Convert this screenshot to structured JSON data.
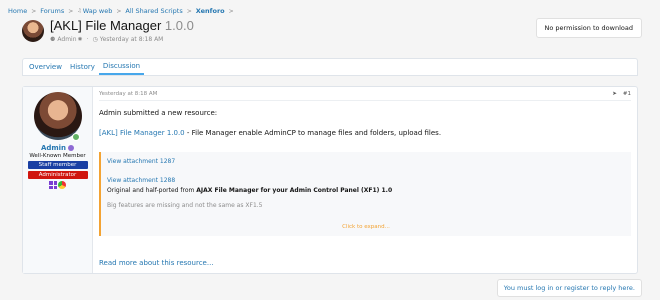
{
  "breadcrumb": [
    {
      "label": "Home"
    },
    {
      "label": "Forums"
    },
    {
      "label": "Wap web",
      "prefix": "♫"
    },
    {
      "label": "All Shared Scripts"
    },
    {
      "label": "Xenforo"
    }
  ],
  "resource": {
    "title": "[AKL] File Manager",
    "version": "1.0.0",
    "author": "Admin",
    "time": "Yesterday at 8:18 AM"
  },
  "download": {
    "label": "No permission to download"
  },
  "tabs": [
    {
      "label": "Overview"
    },
    {
      "label": "History"
    },
    {
      "label": "Discussion",
      "active": true
    }
  ],
  "post": {
    "user": {
      "name": "Admin",
      "title": "Well-Known Member",
      "banners": [
        "Staff member",
        "Administrator"
      ]
    },
    "time": "Yesterday at 8:18 AM",
    "number": "#1",
    "intro": "Admin submitted a new resource:",
    "link_text": "[AKL] File Manager 1.0.0",
    "desc_rest": " - File Manager enable AdminCP to manage files and folders, upload files.",
    "quote": {
      "attachment1": "View attachment 1287",
      "attachment2": "View attachment 1288",
      "line_prefix": "Original and half-ported from ",
      "line_bold": "AJAX File Manager for your Admin Control Panel (XF1) 1.0",
      "muted": "Big features are missing and not the same as XF1.5",
      "expand": "Click to expand..."
    },
    "read_more": "Read more about this resource..."
  },
  "reply_prompt": "You must log in or register to reply here.",
  "colors": {
    "link": "#2577b1",
    "quote_accent": "#f3a333",
    "staff": "#1a3fa3",
    "admin": "#d0160f"
  }
}
